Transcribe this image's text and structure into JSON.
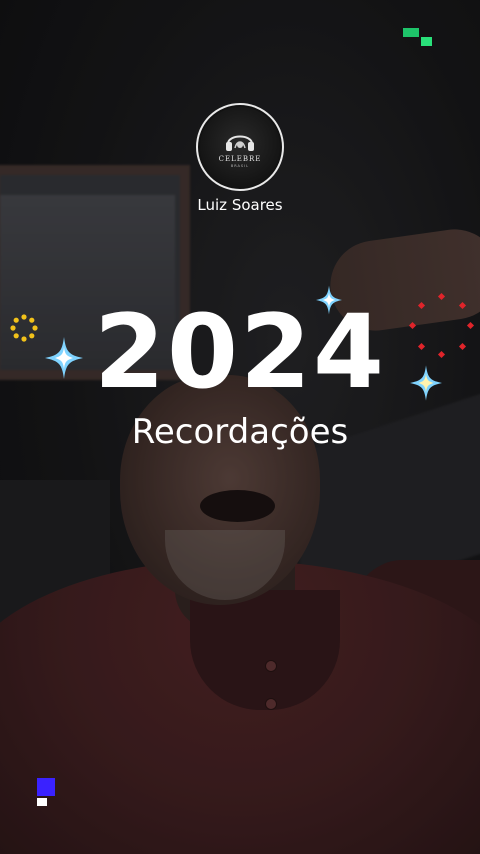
{
  "profile": {
    "username": "Luiz Soares",
    "avatar_brand": "CELEBRE",
    "avatar_brand_sub": "BRASIL"
  },
  "headline": {
    "year": "2024",
    "subtitle": "Recordações"
  },
  "colors": {
    "accent_green": "#22d36b",
    "accent_blue": "#3b2cff",
    "sparkle_blue": "#7fd3ff",
    "sparkle_yellow": "#f2c21a",
    "firework_red": "#e0242a"
  },
  "icons": [
    "sparkle-icon",
    "sun-ring-icon",
    "firework-icon",
    "headphones-logo-icon"
  ]
}
